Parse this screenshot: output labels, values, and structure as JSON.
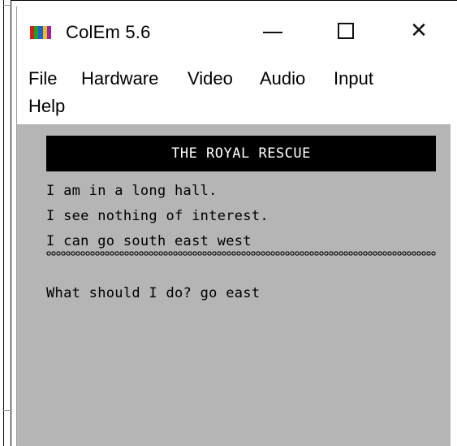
{
  "window": {
    "title": "ColEm 5.6",
    "controls": {
      "minimize_icon": "minimize-icon",
      "maximize_icon": "maximize-icon",
      "close_icon": "close-icon",
      "close_glyph": "✕"
    },
    "icon_colors": [
      "#d02020",
      "#20a020",
      "#2060d0",
      "#e0c020",
      "#a020a0"
    ]
  },
  "menu": {
    "items": [
      {
        "label": "File"
      },
      {
        "label": "Hardware"
      },
      {
        "label": "Video"
      },
      {
        "label": "Audio"
      },
      {
        "label": "Input"
      },
      {
        "label": "Help"
      }
    ]
  },
  "game": {
    "banner": "THE ROYAL RESCUE",
    "lines": [
      "I am in a long hall.",
      "I see nothing of interest.",
      "I can go south east west"
    ],
    "prompt": "What should I do? go east",
    "colors": {
      "background": "#b5b5b5",
      "banner_bg": "#000000",
      "banner_fg": "#ffffff",
      "text": "#000000"
    }
  }
}
